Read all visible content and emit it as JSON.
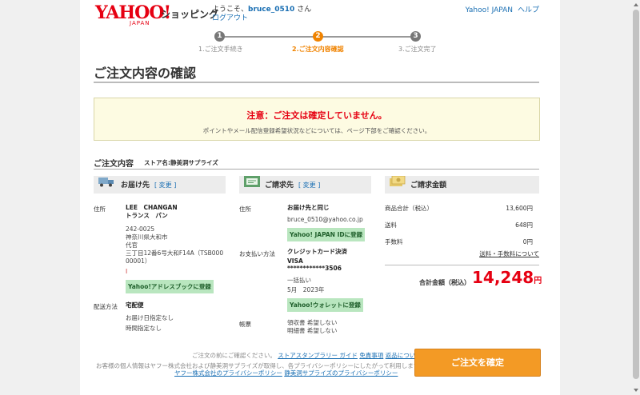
{
  "header": {
    "logo_main": "YAHOO!",
    "logo_sub": "JAPAN",
    "service": "ショッピング",
    "welcome_prefix": "ようこそ、",
    "username": "bruce_0510",
    "welcome_suffix": " さん",
    "logout": "ログアウト",
    "yahoo_japan_link": "Yahoo! JAPAN",
    "help_link": "ヘルプ"
  },
  "steps": [
    {
      "num": "1",
      "label": "1.ご注文手続き",
      "state": "done"
    },
    {
      "num": "2",
      "label": "2.ご注文内容確認",
      "state": "active"
    },
    {
      "num": "3",
      "label": "3.ご注文完了",
      "state": "pending"
    }
  ],
  "page_title": "ご注文内容の確認",
  "warning": {
    "title": "注意：ご注文は確定していません。",
    "text": "ポイントやメール配信登録希望状況などについては、ページ下部をご確認ください。"
  },
  "order": {
    "section_title": "ご注文内容",
    "store_label": "ストア名:静美洞サプライズ"
  },
  "delivery": {
    "heading": "お届け先",
    "change": "[ 変更 ]",
    "address_label": "住所",
    "name_line": "LEE　CHANGAN",
    "kana_line": "トランス　パン",
    "postal": "242-0025",
    "addr1": "神奈川県大和市",
    "addr2": "代官",
    "addr3": "三丁目12番6号大和F14A（TSB000",
    "addr4": "00001）",
    "addr5": "I",
    "address_book_btn": "Yahoo!アドレスブックに登録",
    "method_label": "配送方法",
    "method_value": "宅配便",
    "date_value": "お届け日指定なし",
    "time_value": "時間指定なし"
  },
  "billing": {
    "heading": "ご請求先",
    "change": "[ 変更 ]",
    "address_label": "住所",
    "same_as": "お届け先と同じ",
    "email": "bruce_0510@yahoo.co.jp",
    "id_register_btn": "Yahoo! JAPAN IDに登録",
    "payment_label": "お支払い方法",
    "payment_method": "クレジットカード決済",
    "card_brand": "VISA",
    "card_number": "************3506",
    "installment": "一括払い",
    "expiry": "5月　2023年",
    "wallet_btn": "Yahoo!ウォレットに登録",
    "forms_label": "帳票",
    "receipt": "領収書 希望しない",
    "statement": "明細書 希望しない"
  },
  "amount": {
    "heading": "ご請求金額",
    "rows": [
      {
        "label": "商品合計（税込）",
        "value": "13,600円"
      },
      {
        "label": "送料",
        "value": "648円"
      },
      {
        "label": "手数料",
        "value": "0円"
      }
    ],
    "fee_link": "送料・手数料について",
    "total_label": "合計金額（税込）",
    "total_value": "14,248",
    "total_yen": "円"
  },
  "footer": {
    "line1_prefix": "ご注文の前にご確認ください。",
    "link_guide": "ストアスタンプラリー ガイド",
    "link_disclaimer": "免責事項",
    "link_returns": "返品について",
    "line2": "お客様の個人情報はヤフー株式会社および静美洞サプライズが取得し、各プライバシーポリシーにしたがって利用します。",
    "link_yahoo_privacy": "ヤフー株式会社のプライバシーポリシー",
    "link_store_privacy": "静美洞サプライズのプライバシーポリシー",
    "confirm_btn": "ご注文を確定"
  },
  "colors": {
    "accent": "#f08300",
    "alert": "#e60012",
    "link": "#1a6fb3",
    "badge_green": "#b9e6bf"
  }
}
